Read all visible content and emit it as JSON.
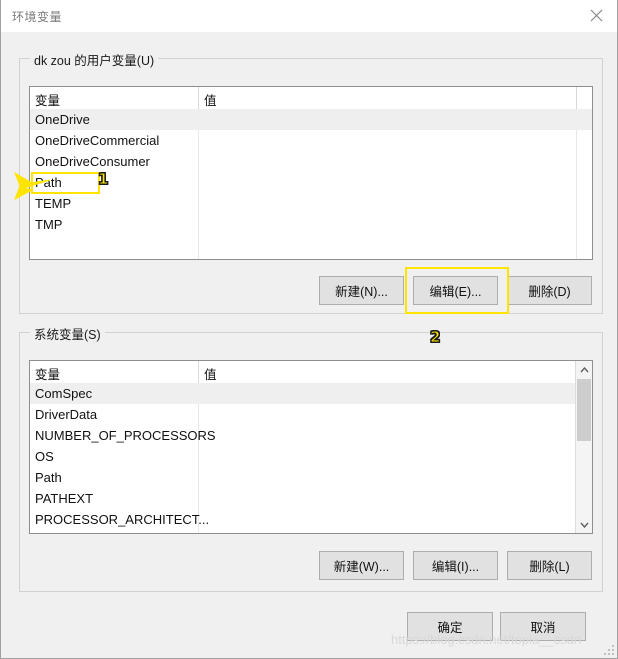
{
  "window": {
    "title": "环境变量",
    "close_icon": "close-icon"
  },
  "user_vars": {
    "group_label": "dk zou 的用户变量(U)",
    "columns": [
      "变量",
      "值"
    ],
    "rows": [
      {
        "name": "OneDrive",
        "value": "",
        "selected": true
      },
      {
        "name": "OneDriveCommercial",
        "value": "",
        "selected": false
      },
      {
        "name": "OneDriveConsumer",
        "value": "",
        "selected": false
      },
      {
        "name": "Path",
        "value": "",
        "selected": false
      },
      {
        "name": "TEMP",
        "value": "",
        "selected": false
      },
      {
        "name": "TMP",
        "value": "",
        "selected": false
      }
    ],
    "buttons": {
      "new": "新建(N)...",
      "edit": "编辑(E)...",
      "delete": "删除(D)"
    }
  },
  "system_vars": {
    "group_label": "系统变量(S)",
    "columns": [
      "变量",
      "值"
    ],
    "rows": [
      {
        "name": "ComSpec",
        "value": "",
        "selected": true
      },
      {
        "name": "DriverData",
        "value": "",
        "selected": false
      },
      {
        "name": "NUMBER_OF_PROCESSORS",
        "value": "",
        "selected": false
      },
      {
        "name": "OS",
        "value": "",
        "selected": false
      },
      {
        "name": "Path",
        "value": "",
        "selected": false
      },
      {
        "name": "PATHEXT",
        "value": "",
        "selected": false
      },
      {
        "name": "PROCESSOR_ARCHITECT...",
        "value": "",
        "selected": false
      }
    ],
    "buttons": {
      "new": "新建(W)...",
      "edit": "编辑(I)...",
      "delete": "删除(L)"
    },
    "scrollbar": {
      "up_icon": "chevron-up-icon",
      "down_icon": "chevron-down-icon"
    }
  },
  "dialog_buttons": {
    "ok": "确定",
    "cancel": "取消"
  },
  "annotations": [
    {
      "marker": "1",
      "target": "user-var-path-row"
    },
    {
      "marker": "2",
      "target": "user-var-edit-button"
    }
  ],
  "watermark": {
    "text": "https://blog.csdn.net/topia__csdn"
  },
  "colors": {
    "dialog_background": "#f0f0f0",
    "button_face": "#e1e1e1",
    "annotation": "#ffe400",
    "selection": "#efefef"
  }
}
